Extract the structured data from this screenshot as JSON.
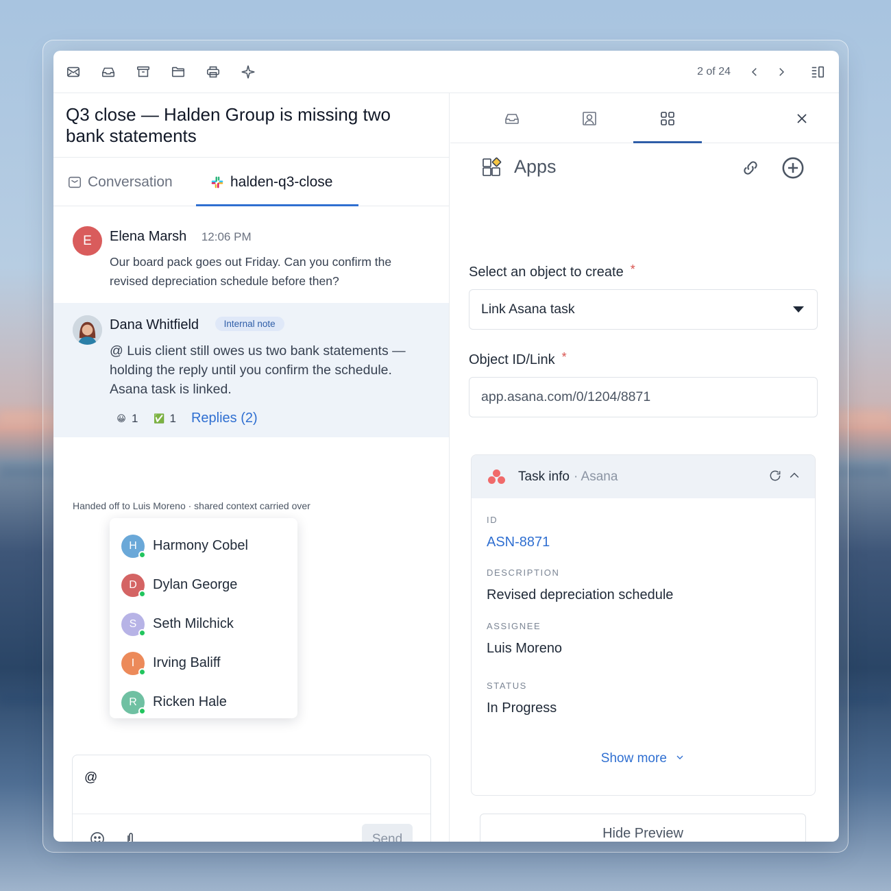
{
  "toolbar": {
    "icons": [
      "mail-icon",
      "inbox-icon",
      "archive-icon",
      "folder-icon",
      "printer-icon",
      "sparkle-icon"
    ],
    "pager": "2 of 24"
  },
  "subject": "Q3 close — Halden Group is missing two bank statements",
  "tabs": {
    "conversation": "Conversation",
    "slack_channel": "halden-q3-close"
  },
  "messages": [
    {
      "avatar_letter": "E",
      "author": "Elena Marsh",
      "time": "12:06 PM",
      "body": "Our board pack goes out Friday. Can you confirm the revised depreciation schedule before then?"
    },
    {
      "author": "Dana Whitfield",
      "badge": "Internal note",
      "body": "@ Luis client still owes us two bank statements — holding the reply until you confirm the schedule. Asana task is linked.",
      "reactions": [
        {
          "emoji": "😀",
          "count": "1"
        },
        {
          "emoji": "✅",
          "count": "1"
        }
      ],
      "replies": "Replies (2)"
    }
  ],
  "handoff_note": "Handed off to Luis Moreno · shared context carried over",
  "mention_list": [
    {
      "letter": "H",
      "name": "Harmony Cobel",
      "color": "#6aa8d8"
    },
    {
      "letter": "D",
      "name": "Dylan George",
      "color": "#d46464"
    },
    {
      "letter": "S",
      "name": "Seth Milchick",
      "color": "#b7b3e6"
    },
    {
      "letter": "I",
      "name": "Irving Baliff",
      "color": "#ec8a5a"
    },
    {
      "letter": "R",
      "name": "Ricken Hale",
      "color": "#6fc0a2"
    }
  ],
  "composer": {
    "value": "@",
    "send": "Send"
  },
  "panel": {
    "title": "Apps",
    "select_label": "Select an object to create",
    "select_value": "Link Asana task",
    "id_label": "Object ID/Link",
    "id_value": "app.asana.com/0/1204/8871",
    "required_mark": "*",
    "card": {
      "title": "Task info",
      "source": "· Asana",
      "fields": [
        {
          "key": "ID",
          "value": "ASN-8871",
          "link": true
        },
        {
          "key": "DESCRIPTION",
          "value": "Revised depreciation schedule"
        },
        {
          "key": "ASSIGNEE",
          "value": "Luis Moreno"
        },
        {
          "key": "STATUS",
          "value": "In Progress"
        }
      ],
      "show_more": "Show more"
    },
    "hide_preview": "Hide Preview"
  },
  "colors": {
    "accent": "#2f6fd1",
    "badge_bg": "#dfe8f8",
    "note_bg": "#eef3f9"
  }
}
